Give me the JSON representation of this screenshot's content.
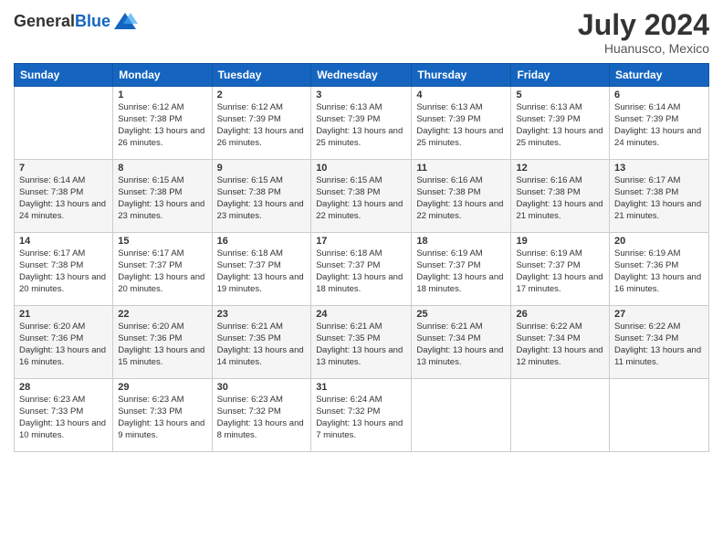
{
  "header": {
    "logo_general": "General",
    "logo_blue": "Blue",
    "month_year": "July 2024",
    "location": "Huanusco, Mexico"
  },
  "weekdays": [
    "Sunday",
    "Monday",
    "Tuesday",
    "Wednesday",
    "Thursday",
    "Friday",
    "Saturday"
  ],
  "weeks": [
    [
      {
        "day": "",
        "sunrise": "",
        "sunset": "",
        "daylight": ""
      },
      {
        "day": "1",
        "sunrise": "Sunrise: 6:12 AM",
        "sunset": "Sunset: 7:38 PM",
        "daylight": "Daylight: 13 hours and 26 minutes."
      },
      {
        "day": "2",
        "sunrise": "Sunrise: 6:12 AM",
        "sunset": "Sunset: 7:39 PM",
        "daylight": "Daylight: 13 hours and 26 minutes."
      },
      {
        "day": "3",
        "sunrise": "Sunrise: 6:13 AM",
        "sunset": "Sunset: 7:39 PM",
        "daylight": "Daylight: 13 hours and 25 minutes."
      },
      {
        "day": "4",
        "sunrise": "Sunrise: 6:13 AM",
        "sunset": "Sunset: 7:39 PM",
        "daylight": "Daylight: 13 hours and 25 minutes."
      },
      {
        "day": "5",
        "sunrise": "Sunrise: 6:13 AM",
        "sunset": "Sunset: 7:39 PM",
        "daylight": "Daylight: 13 hours and 25 minutes."
      },
      {
        "day": "6",
        "sunrise": "Sunrise: 6:14 AM",
        "sunset": "Sunset: 7:39 PM",
        "daylight": "Daylight: 13 hours and 24 minutes."
      }
    ],
    [
      {
        "day": "7",
        "sunrise": "Sunrise: 6:14 AM",
        "sunset": "Sunset: 7:38 PM",
        "daylight": "Daylight: 13 hours and 24 minutes."
      },
      {
        "day": "8",
        "sunrise": "Sunrise: 6:15 AM",
        "sunset": "Sunset: 7:38 PM",
        "daylight": "Daylight: 13 hours and 23 minutes."
      },
      {
        "day": "9",
        "sunrise": "Sunrise: 6:15 AM",
        "sunset": "Sunset: 7:38 PM",
        "daylight": "Daylight: 13 hours and 23 minutes."
      },
      {
        "day": "10",
        "sunrise": "Sunrise: 6:15 AM",
        "sunset": "Sunset: 7:38 PM",
        "daylight": "Daylight: 13 hours and 22 minutes."
      },
      {
        "day": "11",
        "sunrise": "Sunrise: 6:16 AM",
        "sunset": "Sunset: 7:38 PM",
        "daylight": "Daylight: 13 hours and 22 minutes."
      },
      {
        "day": "12",
        "sunrise": "Sunrise: 6:16 AM",
        "sunset": "Sunset: 7:38 PM",
        "daylight": "Daylight: 13 hours and 21 minutes."
      },
      {
        "day": "13",
        "sunrise": "Sunrise: 6:17 AM",
        "sunset": "Sunset: 7:38 PM",
        "daylight": "Daylight: 13 hours and 21 minutes."
      }
    ],
    [
      {
        "day": "14",
        "sunrise": "Sunrise: 6:17 AM",
        "sunset": "Sunset: 7:38 PM",
        "daylight": "Daylight: 13 hours and 20 minutes."
      },
      {
        "day": "15",
        "sunrise": "Sunrise: 6:17 AM",
        "sunset": "Sunset: 7:37 PM",
        "daylight": "Daylight: 13 hours and 20 minutes."
      },
      {
        "day": "16",
        "sunrise": "Sunrise: 6:18 AM",
        "sunset": "Sunset: 7:37 PM",
        "daylight": "Daylight: 13 hours and 19 minutes."
      },
      {
        "day": "17",
        "sunrise": "Sunrise: 6:18 AM",
        "sunset": "Sunset: 7:37 PM",
        "daylight": "Daylight: 13 hours and 18 minutes."
      },
      {
        "day": "18",
        "sunrise": "Sunrise: 6:19 AM",
        "sunset": "Sunset: 7:37 PM",
        "daylight": "Daylight: 13 hours and 18 minutes."
      },
      {
        "day": "19",
        "sunrise": "Sunrise: 6:19 AM",
        "sunset": "Sunset: 7:37 PM",
        "daylight": "Daylight: 13 hours and 17 minutes."
      },
      {
        "day": "20",
        "sunrise": "Sunrise: 6:19 AM",
        "sunset": "Sunset: 7:36 PM",
        "daylight": "Daylight: 13 hours and 16 minutes."
      }
    ],
    [
      {
        "day": "21",
        "sunrise": "Sunrise: 6:20 AM",
        "sunset": "Sunset: 7:36 PM",
        "daylight": "Daylight: 13 hours and 16 minutes."
      },
      {
        "day": "22",
        "sunrise": "Sunrise: 6:20 AM",
        "sunset": "Sunset: 7:36 PM",
        "daylight": "Daylight: 13 hours and 15 minutes."
      },
      {
        "day": "23",
        "sunrise": "Sunrise: 6:21 AM",
        "sunset": "Sunset: 7:35 PM",
        "daylight": "Daylight: 13 hours and 14 minutes."
      },
      {
        "day": "24",
        "sunrise": "Sunrise: 6:21 AM",
        "sunset": "Sunset: 7:35 PM",
        "daylight": "Daylight: 13 hours and 13 minutes."
      },
      {
        "day": "25",
        "sunrise": "Sunrise: 6:21 AM",
        "sunset": "Sunset: 7:34 PM",
        "daylight": "Daylight: 13 hours and 13 minutes."
      },
      {
        "day": "26",
        "sunrise": "Sunrise: 6:22 AM",
        "sunset": "Sunset: 7:34 PM",
        "daylight": "Daylight: 13 hours and 12 minutes."
      },
      {
        "day": "27",
        "sunrise": "Sunrise: 6:22 AM",
        "sunset": "Sunset: 7:34 PM",
        "daylight": "Daylight: 13 hours and 11 minutes."
      }
    ],
    [
      {
        "day": "28",
        "sunrise": "Sunrise: 6:23 AM",
        "sunset": "Sunset: 7:33 PM",
        "daylight": "Daylight: 13 hours and 10 minutes."
      },
      {
        "day": "29",
        "sunrise": "Sunrise: 6:23 AM",
        "sunset": "Sunset: 7:33 PM",
        "daylight": "Daylight: 13 hours and 9 minutes."
      },
      {
        "day": "30",
        "sunrise": "Sunrise: 6:23 AM",
        "sunset": "Sunset: 7:32 PM",
        "daylight": "Daylight: 13 hours and 8 minutes."
      },
      {
        "day": "31",
        "sunrise": "Sunrise: 6:24 AM",
        "sunset": "Sunset: 7:32 PM",
        "daylight": "Daylight: 13 hours and 7 minutes."
      },
      {
        "day": "",
        "sunrise": "",
        "sunset": "",
        "daylight": ""
      },
      {
        "day": "",
        "sunrise": "",
        "sunset": "",
        "daylight": ""
      },
      {
        "day": "",
        "sunrise": "",
        "sunset": "",
        "daylight": ""
      }
    ]
  ]
}
